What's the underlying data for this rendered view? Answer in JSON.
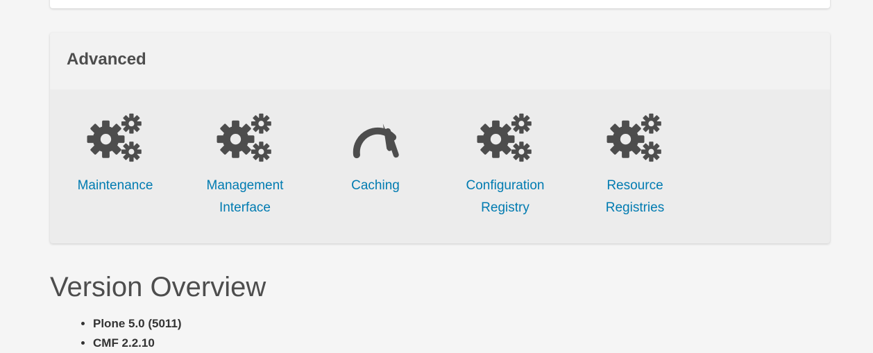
{
  "panel": {
    "title": "Advanced",
    "items": [
      {
        "label": "Maintenance",
        "icon": "gears-icon"
      },
      {
        "label": "Management Interface",
        "icon": "gears-icon"
      },
      {
        "label": "Caching",
        "icon": "dashboard-gauge-icon"
      },
      {
        "label": "Configuration Registry",
        "icon": "gears-icon"
      },
      {
        "label": "Resource Registries",
        "icon": "gears-icon"
      }
    ]
  },
  "version_overview": {
    "title": "Version Overview",
    "items": [
      "Plone 5.0 (5011)",
      "CMF 2.2.10"
    ]
  },
  "colors": {
    "link": "#007bb1",
    "icon": "#4d4d4d",
    "panel_bg": "#ececec",
    "panel_header_bg": "#f2f2f2",
    "page_bg": "#f5f5f5"
  }
}
